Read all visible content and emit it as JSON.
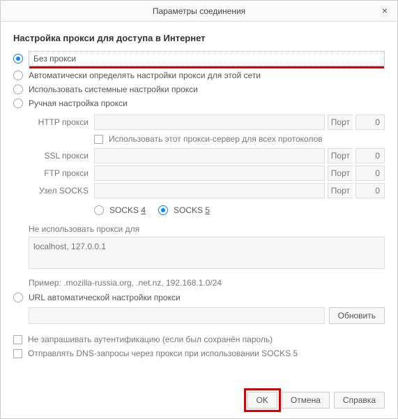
{
  "titlebar": {
    "title": "Параметры соединения",
    "close": "×"
  },
  "section": {
    "heading": "Настройка прокси для доступа в Интернет"
  },
  "radios": {
    "none": "Без прокси",
    "auto": "Автоматически определять настройки прокси для этой сети",
    "system": "Использовать системные настройки прокси",
    "manual": "Ручная настройка прокси",
    "pac": "URL автоматической настройки прокси"
  },
  "labels": {
    "http": "HTTP прокси",
    "ssl": "SSL прокси",
    "ftp": "FTP прокси",
    "socks": "Узел SOCKS",
    "port": "Порт",
    "use_for_all": "Использовать этот прокси-сервер для всех протоколов",
    "socks4": "SOCKS ",
    "socks4_u": "4",
    "socks5": "SOCKS ",
    "socks5_u": "5",
    "noproxy_for": "Не использовать прокси для",
    "noproxy_placeholder": "localhost, 127.0.0.1",
    "example": "Пример: .mozilla-russia.org, .net.nz, 192.168.1.0/24",
    "reload": "Обновить",
    "noauth": "Не запрашивать аутентификацию (если был сохранён пароль)",
    "dns_socks5": "Отправлять DNS-запросы через прокси при использовании SOCKS 5"
  },
  "ports": {
    "http": "0",
    "ssl": "0",
    "ftp": "0",
    "socks": "0"
  },
  "buttons": {
    "ok": "OK",
    "cancel": "Отмена",
    "help": "Справка"
  }
}
